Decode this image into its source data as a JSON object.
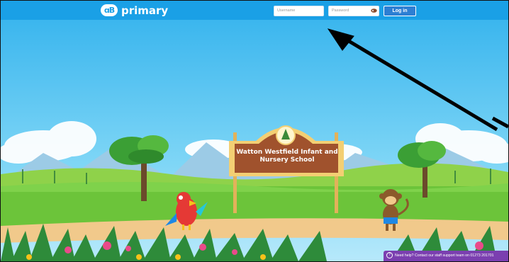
{
  "header": {
    "logo_mark": "ɑB",
    "logo_text": "primary",
    "username_placeholder": "Username",
    "password_placeholder": "Password",
    "login_label": "Log in"
  },
  "scene": {
    "sign_line1": "Watton Westfield Infant and",
    "sign_line2": "Nursery School"
  },
  "help": {
    "icon": "?",
    "text": "Need help? Contact our staff support team on 01273 201701"
  },
  "colors": {
    "topbar": "#1aa0e6",
    "login_button": "#2d7fd3",
    "help_bar": "#7b3fb0",
    "sky": "#5ccaf2",
    "grass": "#6cc43a",
    "path": "#f1c98b",
    "sign_board": "#a0522d"
  },
  "icons": [
    "key-icon",
    "help-icon",
    "annotation-arrow"
  ]
}
